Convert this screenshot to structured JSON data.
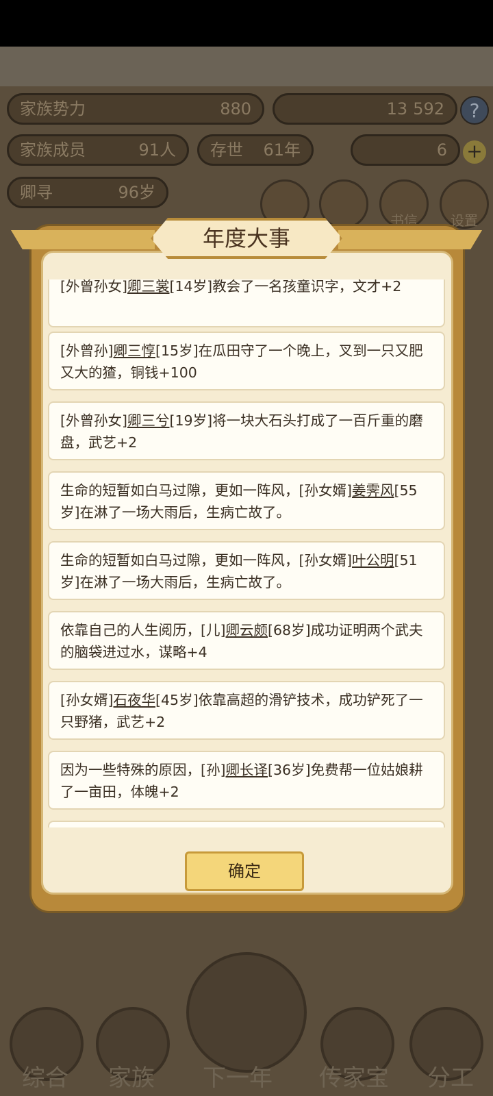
{
  "modal": {
    "title": "年度大事",
    "confirm_label": "确定",
    "events": [
      {
        "pre": "[外曾孙女]",
        "name": "卿三裳",
        "post": "[14岁]教会了一名孩童识字，文才+2"
      },
      {
        "pre": "[外曾孙]",
        "name": "卿三惇",
        "post": "[15岁]在瓜田守了一个晚上，叉到一只又肥又大的猹，铜钱+100"
      },
      {
        "pre": "[外曾孙女]",
        "name": "卿三兮",
        "post": "[19岁]将一块大石头打成了一百斤重的磨盘，武艺+2"
      },
      {
        "pre": "生命的短暂如白马过隙，更如一阵风，[孙女婿]",
        "name": "姜霁风",
        "post": "[55岁]在淋了一场大雨后，生病亡故了。"
      },
      {
        "pre": "生命的短暂如白马过隙，更如一阵风，[孙女婿]",
        "name": "叶公明",
        "post": "[51岁]在淋了一场大雨后，生病亡故了。"
      },
      {
        "pre": "依靠自己的人生阅历，[儿]",
        "name": "卿云颇",
        "post": "[68岁]成功证明两个武夫的脑袋进过水，谋略+4"
      },
      {
        "pre": "[孙女婿]",
        "name": "石夜华",
        "post": "[45岁]依靠高超的滑铲技术，成功铲死了一只野猪，武艺+2"
      },
      {
        "pre": "因为一些特殊的原因，[孙]",
        "name": "卿长译",
        "post": "[36岁]免费帮一位姑娘耕了一亩田，体魄+2"
      }
    ]
  },
  "hud": {
    "power_label": "家族势力",
    "power_value": "880",
    "currency_a": "13",
    "currency_b": "592",
    "members_label": "家族成员",
    "members_value": "91人",
    "alive_label": "存世",
    "alive_value": "61年",
    "gold_value": "6",
    "leader_name": "卿寻",
    "leader_age": "96岁",
    "icon_labels": [
      "书信",
      "设置"
    ]
  },
  "bottom_nav": [
    "综合",
    "家族",
    "下一年",
    "传家宝",
    "分工"
  ]
}
